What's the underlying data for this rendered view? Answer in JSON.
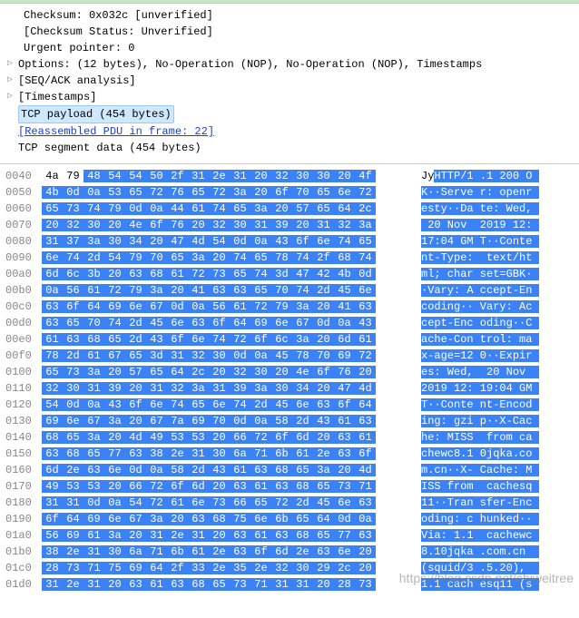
{
  "details": {
    "checksum": "Checksum: 0x032c [unverified]",
    "checksum_status": "[Checksum Status: Unverified]",
    "urgent_pointer": "Urgent pointer: 0",
    "options": "Options: (12 bytes), No-Operation (NOP), No-Operation (NOP), Timestamps",
    "seq_ack": "[SEQ/ACK analysis]",
    "timestamps": "[Timestamps]",
    "tcp_payload": "TCP payload (454 bytes)",
    "reassembled": "[Reassembled PDU in frame: 22]",
    "tcp_segment": "TCP segment data (454 bytes)"
  },
  "hex": {
    "first_row": {
      "offset": "0040",
      "plain_bytes": [
        "4a",
        "79"
      ],
      "sel_bytes": [
        "48",
        "54",
        "54",
        "50",
        "2f",
        "31",
        "2e",
        "31",
        "20",
        "32",
        "30",
        "30",
        "20",
        "4f"
      ],
      "ascii_plain": "Jy",
      "ascii_sel": "HTTP/1 .1 200 O"
    },
    "rows": [
      {
        "offset": "0050",
        "bytes": [
          "4b",
          "0d",
          "0a",
          "53",
          "65",
          "72",
          "76",
          "65",
          "72",
          "3a",
          "20",
          "6f",
          "70",
          "65",
          "6e",
          "72"
        ],
        "ascii": "K··Serve r: openr"
      },
      {
        "offset": "0060",
        "bytes": [
          "65",
          "73",
          "74",
          "79",
          "0d",
          "0a",
          "44",
          "61",
          "74",
          "65",
          "3a",
          "20",
          "57",
          "65",
          "64",
          "2c"
        ],
        "ascii": "esty··Da te: Wed,"
      },
      {
        "offset": "0070",
        "bytes": [
          "20",
          "32",
          "30",
          "20",
          "4e",
          "6f",
          "76",
          "20",
          "32",
          "30",
          "31",
          "39",
          "20",
          "31",
          "32",
          "3a"
        ],
        "ascii": " 20 Nov  2019 12:"
      },
      {
        "offset": "0080",
        "bytes": [
          "31",
          "37",
          "3a",
          "30",
          "34",
          "20",
          "47",
          "4d",
          "54",
          "0d",
          "0a",
          "43",
          "6f",
          "6e",
          "74",
          "65"
        ],
        "ascii": "17:04 GM T··Conte"
      },
      {
        "offset": "0090",
        "bytes": [
          "6e",
          "74",
          "2d",
          "54",
          "79",
          "70",
          "65",
          "3a",
          "20",
          "74",
          "65",
          "78",
          "74",
          "2f",
          "68",
          "74"
        ],
        "ascii": "nt-Type:  text/ht"
      },
      {
        "offset": "00a0",
        "bytes": [
          "6d",
          "6c",
          "3b",
          "20",
          "63",
          "68",
          "61",
          "72",
          "73",
          "65",
          "74",
          "3d",
          "47",
          "42",
          "4b",
          "0d"
        ],
        "ascii": "ml; char set=GBK·"
      },
      {
        "offset": "00b0",
        "bytes": [
          "0a",
          "56",
          "61",
          "72",
          "79",
          "3a",
          "20",
          "41",
          "63",
          "63",
          "65",
          "70",
          "74",
          "2d",
          "45",
          "6e"
        ],
        "ascii": "·Vary: A ccept-En"
      },
      {
        "offset": "00c0",
        "bytes": [
          "63",
          "6f",
          "64",
          "69",
          "6e",
          "67",
          "0d",
          "0a",
          "56",
          "61",
          "72",
          "79",
          "3a",
          "20",
          "41",
          "63"
        ],
        "ascii": "coding·· Vary: Ac"
      },
      {
        "offset": "00d0",
        "bytes": [
          "63",
          "65",
          "70",
          "74",
          "2d",
          "45",
          "6e",
          "63",
          "6f",
          "64",
          "69",
          "6e",
          "67",
          "0d",
          "0a",
          "43"
        ],
        "ascii": "cept-Enc oding··C"
      },
      {
        "offset": "00e0",
        "bytes": [
          "61",
          "63",
          "68",
          "65",
          "2d",
          "43",
          "6f",
          "6e",
          "74",
          "72",
          "6f",
          "6c",
          "3a",
          "20",
          "6d",
          "61"
        ],
        "ascii": "ache-Con trol: ma"
      },
      {
        "offset": "00f0",
        "bytes": [
          "78",
          "2d",
          "61",
          "67",
          "65",
          "3d",
          "31",
          "32",
          "30",
          "0d",
          "0a",
          "45",
          "78",
          "70",
          "69",
          "72"
        ],
        "ascii": "x-age=12 0··Expir"
      },
      {
        "offset": "0100",
        "bytes": [
          "65",
          "73",
          "3a",
          "20",
          "57",
          "65",
          "64",
          "2c",
          "20",
          "32",
          "30",
          "20",
          "4e",
          "6f",
          "76",
          "20"
        ],
        "ascii": "es: Wed,  20 Nov "
      },
      {
        "offset": "0110",
        "bytes": [
          "32",
          "30",
          "31",
          "39",
          "20",
          "31",
          "32",
          "3a",
          "31",
          "39",
          "3a",
          "30",
          "34",
          "20",
          "47",
          "4d"
        ],
        "ascii": "2019 12: 19:04 GM"
      },
      {
        "offset": "0120",
        "bytes": [
          "54",
          "0d",
          "0a",
          "43",
          "6f",
          "6e",
          "74",
          "65",
          "6e",
          "74",
          "2d",
          "45",
          "6e",
          "63",
          "6f",
          "64"
        ],
        "ascii": "T··Conte nt-Encod"
      },
      {
        "offset": "0130",
        "bytes": [
          "69",
          "6e",
          "67",
          "3a",
          "20",
          "67",
          "7a",
          "69",
          "70",
          "0d",
          "0a",
          "58",
          "2d",
          "43",
          "61",
          "63"
        ],
        "ascii": "ing: gzi p··X-Cac"
      },
      {
        "offset": "0140",
        "bytes": [
          "68",
          "65",
          "3a",
          "20",
          "4d",
          "49",
          "53",
          "53",
          "20",
          "66",
          "72",
          "6f",
          "6d",
          "20",
          "63",
          "61"
        ],
        "ascii": "he: MISS  from ca"
      },
      {
        "offset": "0150",
        "bytes": [
          "63",
          "68",
          "65",
          "77",
          "63",
          "38",
          "2e",
          "31",
          "30",
          "6a",
          "71",
          "6b",
          "61",
          "2e",
          "63",
          "6f"
        ],
        "ascii": "chewc8.1 0jqka.co"
      },
      {
        "offset": "0160",
        "bytes": [
          "6d",
          "2e",
          "63",
          "6e",
          "0d",
          "0a",
          "58",
          "2d",
          "43",
          "61",
          "63",
          "68",
          "65",
          "3a",
          "20",
          "4d"
        ],
        "ascii": "m.cn··X- Cache: M"
      },
      {
        "offset": "0170",
        "bytes": [
          "49",
          "53",
          "53",
          "20",
          "66",
          "72",
          "6f",
          "6d",
          "20",
          "63",
          "61",
          "63",
          "68",
          "65",
          "73",
          "71"
        ],
        "ascii": "ISS from  cachesq"
      },
      {
        "offset": "0180",
        "bytes": [
          "31",
          "31",
          "0d",
          "0a",
          "54",
          "72",
          "61",
          "6e",
          "73",
          "66",
          "65",
          "72",
          "2d",
          "45",
          "6e",
          "63"
        ],
        "ascii": "11··Tran sfer-Enc"
      },
      {
        "offset": "0190",
        "bytes": [
          "6f",
          "64",
          "69",
          "6e",
          "67",
          "3a",
          "20",
          "63",
          "68",
          "75",
          "6e",
          "6b",
          "65",
          "64",
          "0d",
          "0a"
        ],
        "ascii": "oding: c hunked··"
      },
      {
        "offset": "01a0",
        "bytes": [
          "56",
          "69",
          "61",
          "3a",
          "20",
          "31",
          "2e",
          "31",
          "20",
          "63",
          "61",
          "63",
          "68",
          "65",
          "77",
          "63"
        ],
        "ascii": "Via: 1.1  cachewc"
      },
      {
        "offset": "01b0",
        "bytes": [
          "38",
          "2e",
          "31",
          "30",
          "6a",
          "71",
          "6b",
          "61",
          "2e",
          "63",
          "6f",
          "6d",
          "2e",
          "63",
          "6e",
          "20"
        ],
        "ascii": "8.10jqka .com.cn "
      },
      {
        "offset": "01c0",
        "bytes": [
          "28",
          "73",
          "71",
          "75",
          "69",
          "64",
          "2f",
          "33",
          "2e",
          "35",
          "2e",
          "32",
          "30",
          "29",
          "2c",
          "20"
        ],
        "ascii": "(squid/3 .5.20), "
      },
      {
        "offset": "01d0",
        "bytes": [
          "31",
          "2e",
          "31",
          "20",
          "63",
          "61",
          "63",
          "68",
          "65",
          "73",
          "71",
          "31",
          "31",
          "20",
          "28",
          "73"
        ],
        "ascii": "1.1 cach esq11 (s"
      }
    ]
  },
  "watermark": "https://blog.csdn.net/chiweitree"
}
